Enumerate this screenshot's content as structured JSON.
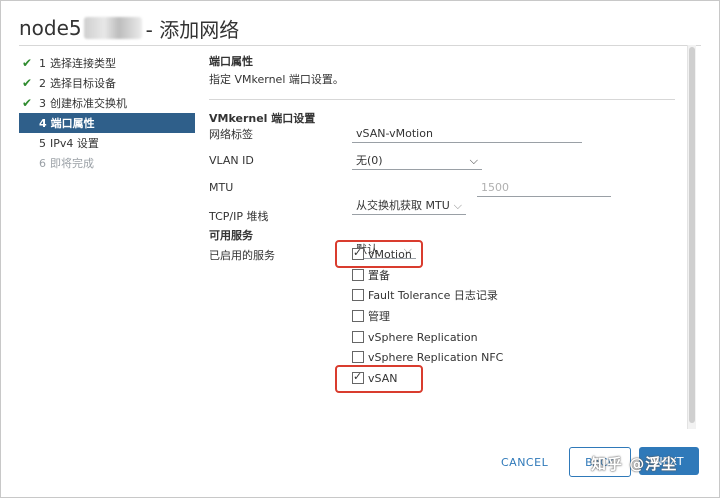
{
  "window": {
    "host": "node5",
    "title": " - 添加网络"
  },
  "steps": [
    {
      "num": "1",
      "label": "选择连接类型",
      "state": "done"
    },
    {
      "num": "2",
      "label": "选择目标设备",
      "state": "done"
    },
    {
      "num": "3",
      "label": "创建标准交换机",
      "state": "done"
    },
    {
      "num": "4",
      "label": "端口属性",
      "state": "active"
    },
    {
      "num": "5",
      "label": "IPv4 设置",
      "state": "pending"
    },
    {
      "num": "6",
      "label": "即将完成",
      "state": "disabled"
    }
  ],
  "section": {
    "title": "端口属性",
    "description": "指定 VMkernel 端口设置。"
  },
  "vmkernel": {
    "heading": "VMkernel 端口设置",
    "network_label_label": "网络标签",
    "network_label_value": "vSAN-vMotion",
    "vlan_label": "VLAN ID",
    "vlan_value": "无(0)",
    "mtu_label": "MTU",
    "mtu_select": "从交换机获取 MTU",
    "mtu_placeholder": "1500",
    "tcpip_label": "TCP/IP 堆栈",
    "tcpip_value": "默认"
  },
  "services": {
    "heading": "可用服务",
    "enabled_label": "已启用的服务",
    "items": [
      {
        "label": "vMotion",
        "checked": true
      },
      {
        "label": "置备",
        "checked": false
      },
      {
        "label": "Fault Tolerance 日志记录",
        "checked": false
      },
      {
        "label": "管理",
        "checked": false
      },
      {
        "label": "vSphere Replication",
        "checked": false
      },
      {
        "label": "vSphere Replication NFC",
        "checked": false
      },
      {
        "label": "vSAN",
        "checked": true
      }
    ]
  },
  "footer": {
    "cancel": "CANCEL",
    "back": "BACK",
    "next": "NEXT",
    "watermark": "知乎 @浮尘"
  },
  "colors": {
    "active_step_bg": "#2f5f8a",
    "check_green": "#2e8b2e",
    "primary_blue": "#2f79b9",
    "highlight_red": "#d93c2e"
  }
}
